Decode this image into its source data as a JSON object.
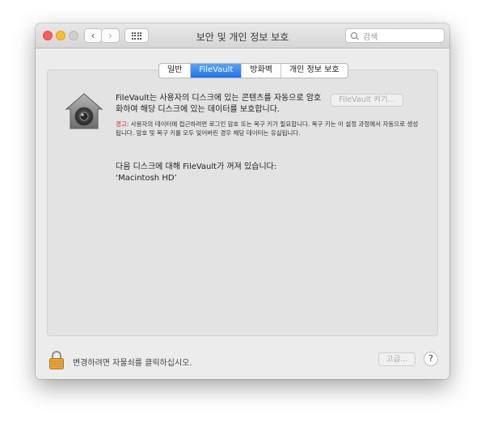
{
  "window": {
    "title": "보안 및 개인 정보 보호"
  },
  "toolbar": {
    "back_label": "‹",
    "forward_label": "›"
  },
  "search": {
    "placeholder": "검색"
  },
  "tabs": [
    {
      "label": "일반",
      "active": false
    },
    {
      "label": "FileVault",
      "active": true
    },
    {
      "label": "방화벽",
      "active": false
    },
    {
      "label": "개인 정보 보호",
      "active": false
    }
  ],
  "filevault": {
    "description": "FileVault는 사용자의 디스크에 있는 콘텐츠를 자동으로 암호화하여 해당 디스크에 있는 데이터를 보호합니다.",
    "turn_on_button": "FileVault 켜기...",
    "warning_label": "경고:",
    "warning_text": " 사용자의 데이터에 접근하려면 로그인 암호 또는 복구 키가 필요합니다. 복구 키는 이 설정 과정에서 자동으로 생성됩니다. 암호 및 복구 키를 모두 잊어버린 경우 해당 데이터는 유실됩니다.",
    "status_line": "다음 디스크에 대해 FileVault가 꺼져 있습니다:",
    "disk_name": "‘Macintosh HD’"
  },
  "footer": {
    "lock_text": "변경하려면 자물쇠를 클릭하십시오.",
    "advanced_button": "고급...",
    "help_button": "?"
  },
  "colors": {
    "accent": "#1f73ea",
    "warning": "#d32b2b",
    "close": "#fc5f57",
    "minimize": "#fdbc2e"
  }
}
